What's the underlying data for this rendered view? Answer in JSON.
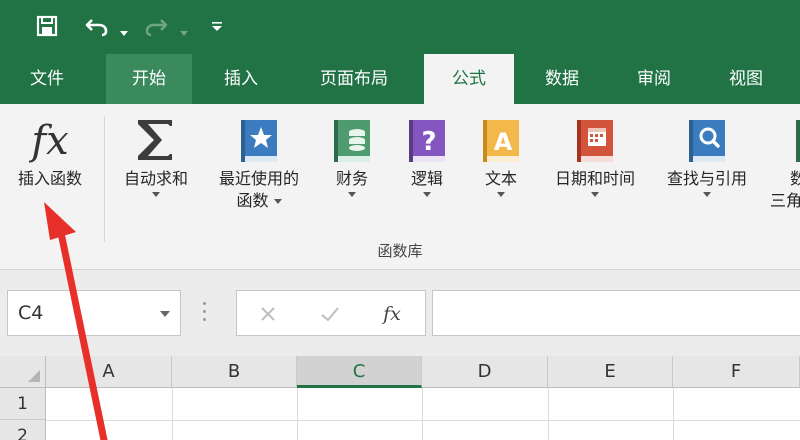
{
  "quick_access": {
    "items": [
      "save-icon",
      "undo-icon",
      "redo-icon",
      "customize-qat-icon"
    ]
  },
  "tabs": {
    "file": "文件",
    "home": "开始",
    "insert": "插入",
    "page_layout": "页面布局",
    "formulas": "公式",
    "data": "数据",
    "review": "审阅",
    "view": "视图"
  },
  "ribbon": {
    "insert_function": "插入函数",
    "autosum": "自动求和",
    "recently_used_line1": "最近使用的",
    "recently_used_line2": "函数",
    "financial": "财务",
    "logical": "逻辑",
    "text": "文本",
    "date_time": "日期和时间",
    "lookup_reference": "查找与引用",
    "math_trig_line1": "数",
    "math_trig_line2": "三角",
    "group_label": "函数库"
  },
  "formula_bar": {
    "name_box": "C4",
    "fx_label": "fx"
  },
  "grid": {
    "columns": [
      "A",
      "B",
      "C",
      "D",
      "E",
      "F"
    ],
    "rows": [
      "1",
      "2"
    ],
    "selected_column": "C"
  },
  "colors": {
    "excel_green": "#217346",
    "ribbon_bg": "#f3f3f3",
    "arrow_red": "#e8302a"
  }
}
